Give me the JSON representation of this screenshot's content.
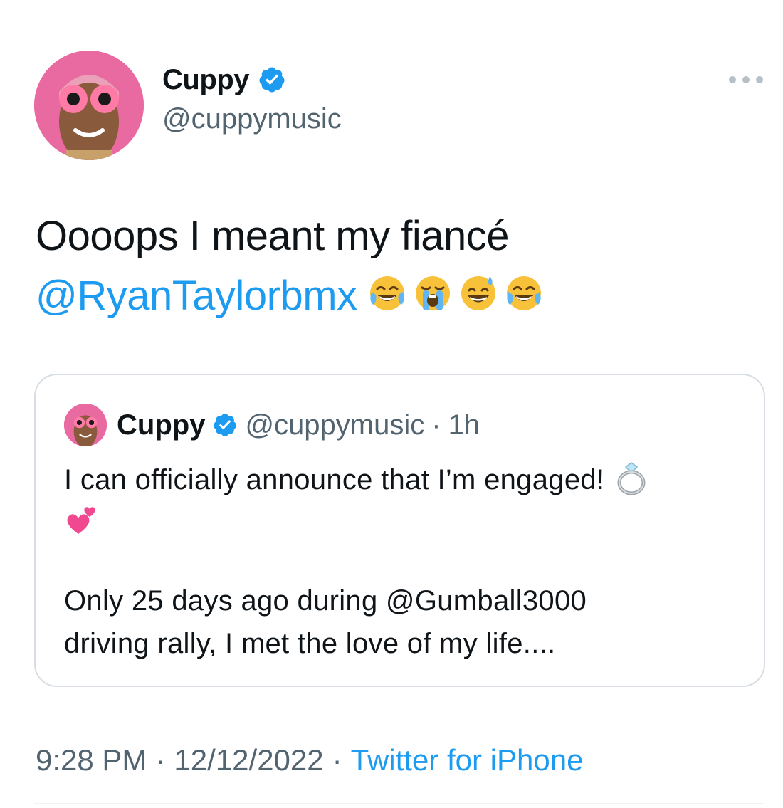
{
  "tweet": {
    "author": {
      "display_name": "Cuppy",
      "handle": "@cuppymusic",
      "verified": true
    },
    "more_icon": "more-horizontal-icon",
    "text": "Oooops I meant my fiancé",
    "mention": "@RyanTaylorbmx",
    "emojis": [
      "face-with-tears-of-joy",
      "loudly-crying-face",
      "grinning-face-with-sweat",
      "face-with-tears-of-joy"
    ],
    "quoted_tweet": {
      "display_name": "Cuppy",
      "handle": "@cuppymusic",
      "separator": "·",
      "time": "1h",
      "line1": "I can officially announce that I’m engaged!",
      "line1_emoji": "ring",
      "line2_emoji": "two-hearts",
      "paragraph2_line1": "Only 25 days ago during @Gumball3000",
      "paragraph2_line2": "driving rally, I met the love of my life...."
    },
    "meta": {
      "time": "9:28 PM",
      "separator": "·",
      "date": "12/12/2022",
      "source": "Twitter for iPhone"
    }
  },
  "colors": {
    "link": "#1d9bf0",
    "secondary_text": "#536471",
    "verified_badge": "#1d9bf0",
    "border": "#d7dde2"
  }
}
